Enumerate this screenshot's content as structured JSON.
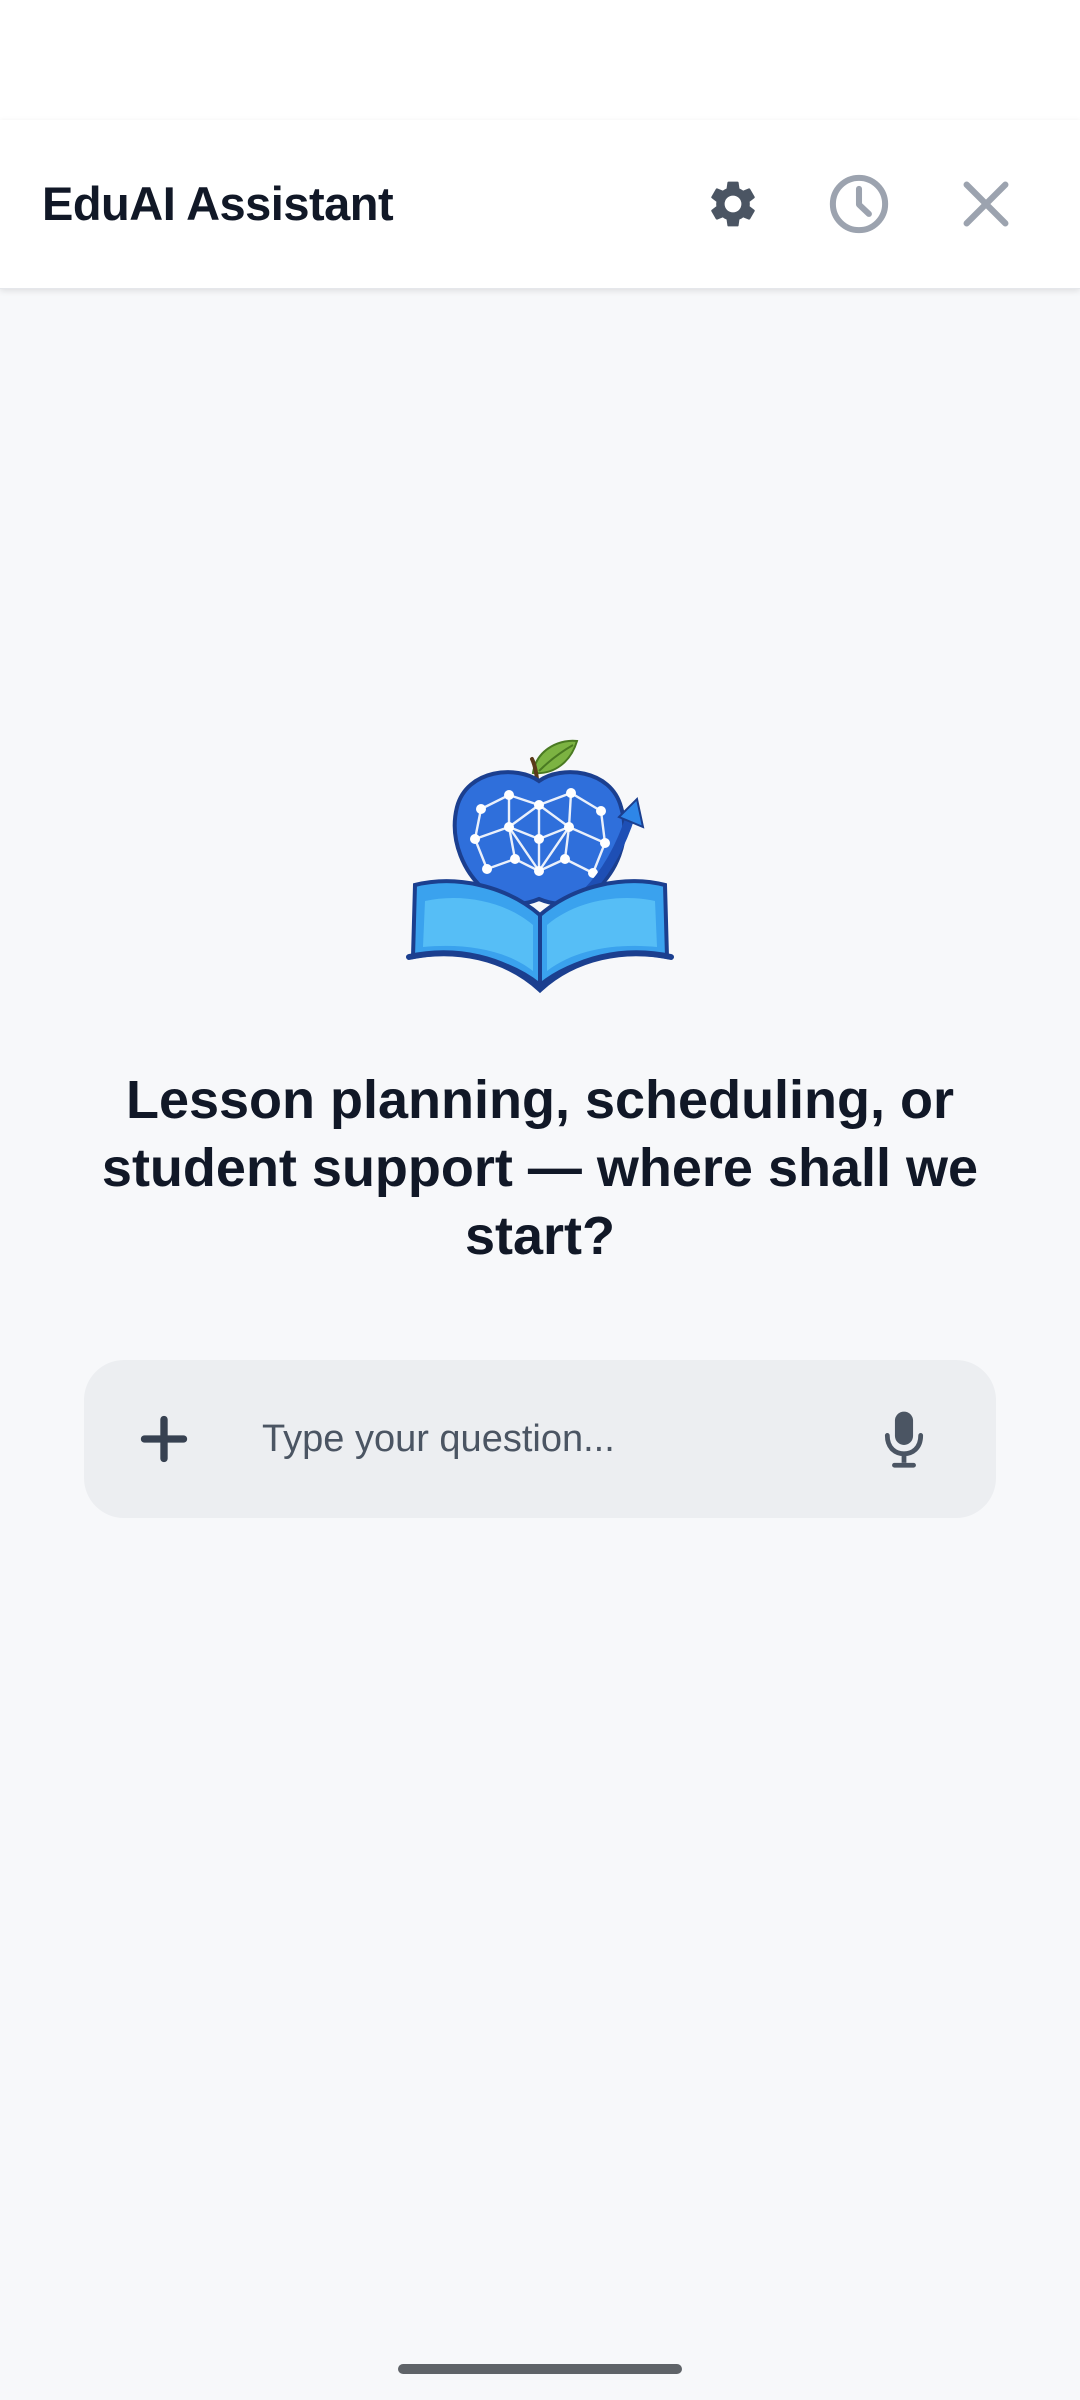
{
  "header": {
    "title": "EduAI Assistant",
    "settings_icon": "gear-icon",
    "history_icon": "clock-icon",
    "close_icon": "close-icon"
  },
  "hero": {
    "logo": "brain-apple-book-logo",
    "headline": "Lesson planning, scheduling, or student support — where shall we start?"
  },
  "composer": {
    "add_icon": "plus-icon",
    "placeholder": "Type your question...",
    "value": "",
    "mic_icon": "microphone-icon"
  },
  "colors": {
    "text_primary": "#111827",
    "header_icon": "#4b5563",
    "page_background": "#f7f8fa",
    "composer_background": "#eceef1",
    "logo_blue": "#2f6fdb",
    "logo_leaf": "#7cb342"
  }
}
